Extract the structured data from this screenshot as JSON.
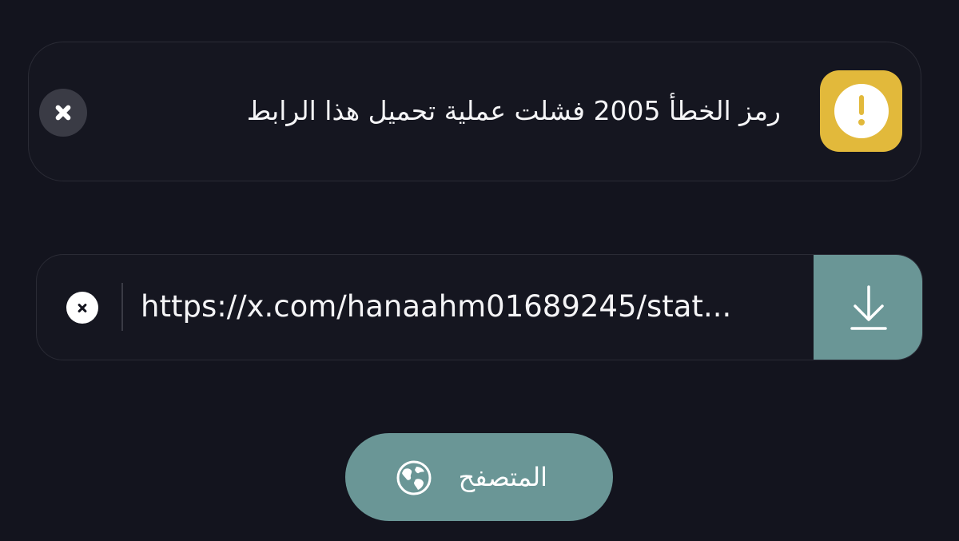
{
  "error_banner": {
    "message": "رمز الخطأ 2005 فشلت عملية تحميل هذا الرابط",
    "icon": "warning-icon",
    "badge_color": "#e2b93b",
    "dismiss_icon": "close-icon"
  },
  "url_bar": {
    "value": "https://x.com/hanaahm01689245/stat...",
    "clear_icon": "clear-icon",
    "download_icon": "download-icon",
    "accent_color": "#6a9696"
  },
  "browser_button": {
    "label": "المتصفح",
    "icon": "globe-icon"
  }
}
